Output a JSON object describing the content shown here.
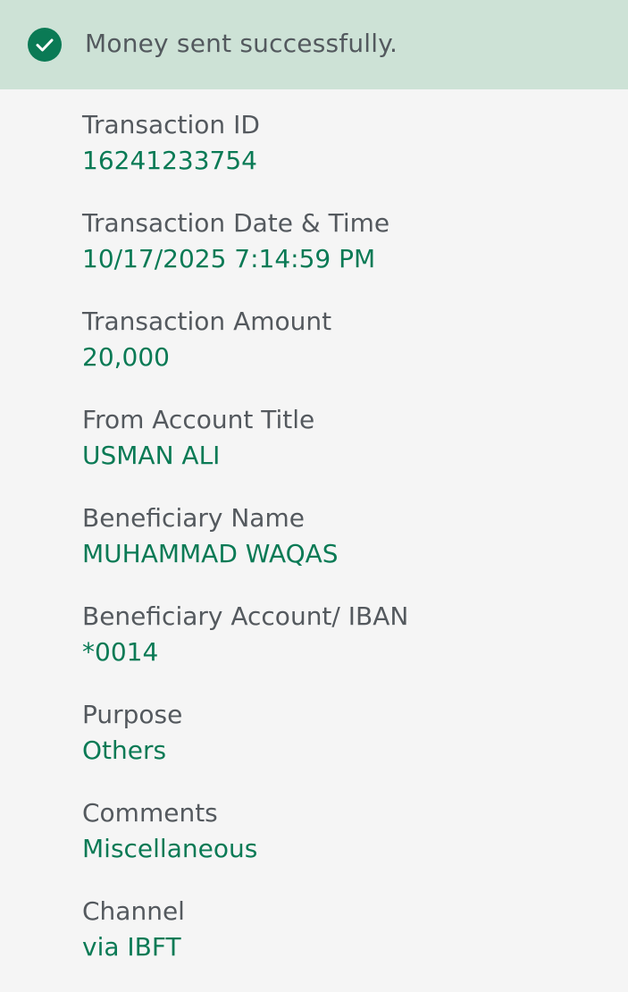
{
  "banner": {
    "icon": "check-circle-icon",
    "message": "Money sent successfully.",
    "bg_color": "#cde2d6",
    "accent_color": "#0a7a55"
  },
  "details": {
    "transaction_id": {
      "label": "Transaction ID",
      "value": "16241233754"
    },
    "date_time": {
      "label": "Transaction Date & Time",
      "value": "10/17/2025 7:14:59 PM"
    },
    "amount": {
      "label": "Transaction Amount",
      "value": "20,000"
    },
    "from_account": {
      "label": "From Account Title",
      "value": "USMAN ALI"
    },
    "beneficiary_name": {
      "label": "Beneficiary Name",
      "value": "MUHAMMAD WAQAS"
    },
    "beneficiary_account": {
      "label": "Beneficiary Account/ IBAN",
      "value": "*0014"
    },
    "purpose": {
      "label": "Purpose",
      "value": "Others"
    },
    "comments": {
      "label": "Comments",
      "value": "Miscellaneous"
    },
    "channel": {
      "label": "Channel",
      "value": "via IBFT"
    }
  }
}
